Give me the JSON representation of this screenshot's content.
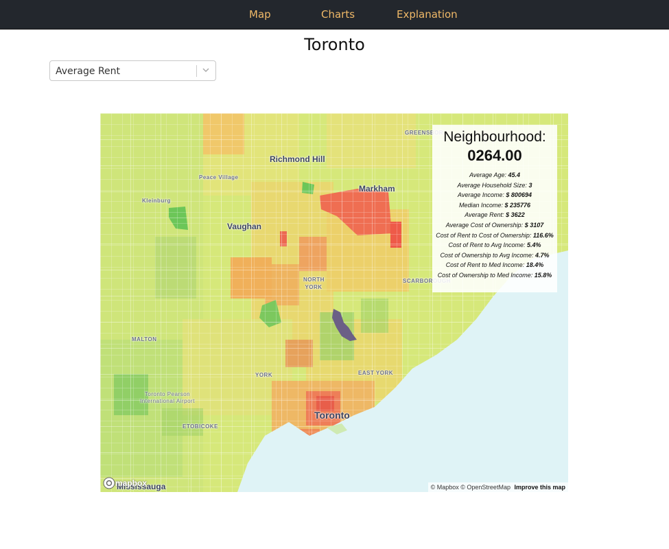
{
  "nav": {
    "items": [
      {
        "label": "Map"
      },
      {
        "label": "Charts"
      },
      {
        "label": "Explanation"
      }
    ]
  },
  "page": {
    "title": "Toronto"
  },
  "metric_select": {
    "value": "Average Rent"
  },
  "map": {
    "labels": {
      "greensborough": "GREENSBOR",
      "richmond_hill": "Richmond Hill",
      "markham": "Markham",
      "peace_village": "Peace Village",
      "kleinburg": "Kleinburg",
      "vaughan": "Vaughan",
      "north_york": "NORTH YORK",
      "scarborough": "SCARBOROUGH",
      "malton": "MALTON",
      "york": "YORK",
      "east_york": "EAST YORK",
      "pearson": "Toronto Pearson International Airport",
      "etobicoke": "ETOBICOKE",
      "toronto": "Toronto",
      "mississauga": "Mississauga"
    },
    "attribution": {
      "mapbox": "© Mapbox",
      "osm": "© OpenStreetMap",
      "improve": "Improve this map"
    },
    "logo_text": "mapbox",
    "colors": {
      "base": "#d6e87a",
      "water": "#dff3f6",
      "selected": "#6b5f86",
      "high": "#ef6a4e",
      "mid": "#f2b35a",
      "low": "#74c75a"
    }
  },
  "info_panel": {
    "heading": "Neighbourhood:",
    "code": "0264.00",
    "rows": [
      {
        "label": "Average Age:",
        "value": "45.4"
      },
      {
        "label": "Average Household Size:",
        "value": "3"
      },
      {
        "label": "Average Income:",
        "value": "$ 800694"
      },
      {
        "label": "Median Income:",
        "value": "$ 235776"
      },
      {
        "label": "Average Rent:",
        "value": "$ 3622"
      },
      {
        "label": "Average Cost of Ownership:",
        "value": "$ 3107"
      },
      {
        "label": "Cost of Rent to Cost of Ownership:",
        "value": "116.6%"
      },
      {
        "label": "Cost of Rent to Avg Income:",
        "value": "5.4%"
      },
      {
        "label": "Cost of Ownership to Avg Income:",
        "value": "4.7%"
      },
      {
        "label": "Cost of Rent to Med Income:",
        "value": "18.4%"
      },
      {
        "label": "Cost of Ownership to Med Income:",
        "value": "15.8%"
      }
    ]
  }
}
